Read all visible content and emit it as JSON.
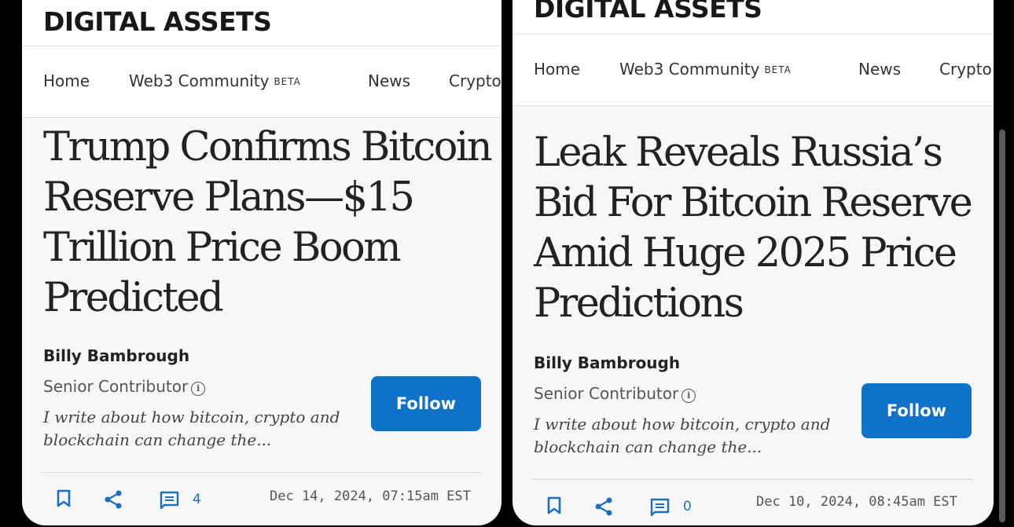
{
  "colors": {
    "accent": "#0f72c9",
    "icon": "#1a6fbf",
    "page_bg": "#f7f7f7",
    "backdrop": "#000000"
  },
  "icons": [
    "bookmark-icon",
    "share-icon",
    "comment-icon",
    "info-icon"
  ],
  "articles": [
    {
      "brand": "DIGITAL ASSETS",
      "nav": {
        "home": "Home",
        "web3": "Web3 Community",
        "beta": "BETA",
        "news": "News",
        "crypto": "Crypto"
      },
      "headline": "Trump Confirms Bitcoin Reserve Plans—$15 Trillion Price Boom Predicted",
      "author": "Billy Bambrough",
      "role": "Senior Contributor",
      "bio": "I write about how bitcoin, crypto and blockchain can change the...",
      "follow_label": "Follow",
      "comment_count": "4",
      "date": "Dec 14, 2024, 07:15am EST"
    },
    {
      "brand": "DIGITAL ASSETS",
      "nav": {
        "home": "Home",
        "web3": "Web3 Community",
        "beta": "BETA",
        "news": "News",
        "crypto": "Crypto"
      },
      "headline": "Leak Reveals Russia’s Bid For Bitcoin Reserve Amid Huge 2025 Price Predictions",
      "author": "Billy Bambrough",
      "role": "Senior Contributor",
      "bio": "I write about how bitcoin, crypto and blockchain can change the...",
      "follow_label": "Follow",
      "comment_count": "0",
      "date": "Dec 10, 2024, 08:45am EST"
    }
  ]
}
